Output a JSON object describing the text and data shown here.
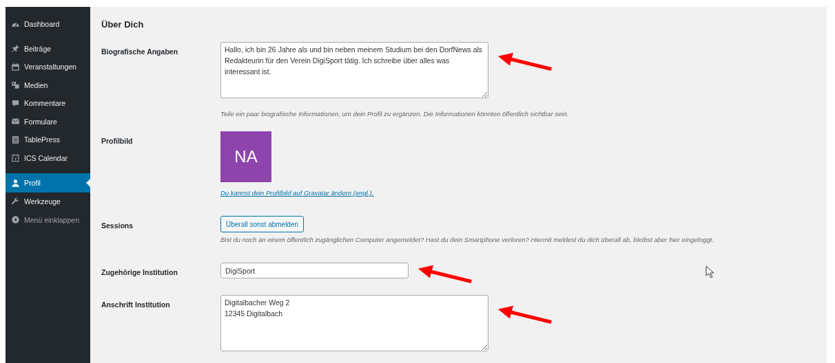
{
  "sidebar": {
    "items": [
      {
        "label": "Dashboard",
        "kind": "dashboard",
        "selected": false
      },
      {
        "label": "Beiträge",
        "kind": "pin",
        "selected": false
      },
      {
        "label": "Veranstaltungen",
        "kind": "calendar",
        "selected": false
      },
      {
        "label": "Medien",
        "kind": "media",
        "selected": false
      },
      {
        "label": "Kommentare",
        "kind": "comment",
        "selected": false
      },
      {
        "label": "Formulare",
        "kind": "mail",
        "selected": false
      },
      {
        "label": "TablePress",
        "kind": "table",
        "selected": false
      },
      {
        "label": "ICS Calendar",
        "kind": "ics",
        "selected": false
      },
      {
        "label": "Profil",
        "kind": "user",
        "selected": true
      },
      {
        "label": "Werkzeuge",
        "kind": "wrench",
        "selected": false
      },
      {
        "label": "Menü einklappen",
        "kind": "collapse",
        "selected": false
      }
    ]
  },
  "section": {
    "heading": "Über Dich",
    "rows": [
      {
        "kind": "textarea",
        "label": "Biografische Angaben",
        "value": "Hallo, ich bin 26 Jahre als und bin neben meinem Studium bei den DorfNews als Redakteurin für den Verein DigiSport tätig. Ich schreibe über alles was interessant ist.",
        "description": "Teile ein paar biografische Informationen, um dein Profil zu ergänzen. Die Informationen könnten öffentlich sichtbar sein.",
        "annotated": true
      },
      {
        "kind": "avatar",
        "label": "Profilbild",
        "initials": "NA",
        "color": "#8e44ad",
        "link": "Du kannst dein Profilbild auf Gravatar ändern (engl.)."
      },
      {
        "kind": "button",
        "label": "Sessions",
        "button": "Überall sonst abmelden",
        "description": "Bist du noch an einem öffentlich zugänglichen Computer angemeldet? Hast du dein Smartphone verloren? Hiermit meldest du dich überall ab, bleibst aber hier eingeloggt."
      },
      {
        "kind": "input",
        "label": "Zugehörige Institution",
        "value": "DigiSport",
        "annotated": true
      },
      {
        "kind": "textarea",
        "label": "Anschrift Institution",
        "value": "Digitalbacher Weg 2\n12345 Digitalbach",
        "annotated": true
      }
    ]
  }
}
